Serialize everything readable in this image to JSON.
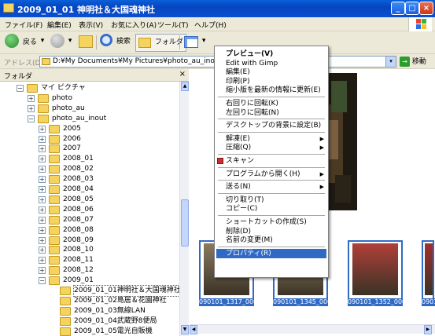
{
  "window": {
    "title": "2009_01_01 神明社＆大国魂神社",
    "min_glyph": "_",
    "max_glyph": "□",
    "close_glyph": "×"
  },
  "menubar": {
    "items": [
      "ファイル(F)",
      "編集(E)",
      "表示(V)",
      "お気に入り(A)",
      "ツール(T)",
      "ヘルプ(H)"
    ]
  },
  "toolbar": {
    "back_label": "戻る",
    "search_label": "検索",
    "folders_label": "フォルダ",
    "dropdown_glyph": "▾"
  },
  "address": {
    "label": "アドレス(D)",
    "value": "D:¥My Documents¥My Pictures¥photo_au_inout¥2009_0",
    "dropdown_glyph": "▾",
    "go_label": "移動",
    "go_glyph": "→"
  },
  "folder_pane": {
    "title": "フォルダ",
    "close_glyph": "×",
    "expand_glyph": "+",
    "collapse_glyph": "−",
    "tree": [
      {
        "label": "マイ ピクチャ",
        "depth": 0,
        "expander": "minus"
      },
      {
        "label": "photo",
        "depth": 1,
        "expander": "plus"
      },
      {
        "label": "photo_au",
        "depth": 1,
        "expander": "plus"
      },
      {
        "label": "photo_au_inout",
        "depth": 1,
        "expander": "minus"
      },
      {
        "label": "2005",
        "depth": 2,
        "expander": "plus"
      },
      {
        "label": "2006",
        "depth": 2,
        "expander": "plus"
      },
      {
        "label": "2007",
        "depth": 2,
        "expander": "plus"
      },
      {
        "label": "2008_01",
        "depth": 2,
        "expander": "plus"
      },
      {
        "label": "2008_02",
        "depth": 2,
        "expander": "plus"
      },
      {
        "label": "2008_03",
        "depth": 2,
        "expander": "plus"
      },
      {
        "label": "2008_04",
        "depth": 2,
        "expander": "plus"
      },
      {
        "label": "2008_05",
        "depth": 2,
        "expander": "plus"
      },
      {
        "label": "2008_06",
        "depth": 2,
        "expander": "plus"
      },
      {
        "label": "2008_07",
        "depth": 2,
        "expander": "plus"
      },
      {
        "label": "2008_08",
        "depth": 2,
        "expander": "plus"
      },
      {
        "label": "2008_09",
        "depth": 2,
        "expander": "plus"
      },
      {
        "label": "2008_10",
        "depth": 2,
        "expander": "plus"
      },
      {
        "label": "2008_11",
        "depth": 2,
        "expander": "plus"
      },
      {
        "label": "2008_12",
        "depth": 2,
        "expander": "plus"
      },
      {
        "label": "2009_01",
        "depth": 2,
        "expander": "minus"
      },
      {
        "label": "2009_01_01神明社＆大国魂神社",
        "depth": 3,
        "expander": "none",
        "selected": true
      },
      {
        "label": "2009_01_02島居＆花園神社",
        "depth": 3,
        "expander": "none"
      },
      {
        "label": "2009_01_03無線LAN",
        "depth": 3,
        "expander": "none"
      },
      {
        "label": "2009_01_04武蔵野8便局",
        "depth": 3,
        "expander": "none"
      },
      {
        "label": "2009_01_05電光自販機",
        "depth": 3,
        "expander": "none"
      }
    ]
  },
  "thumbnails": [
    {
      "caption": "090101_1317_0001"
    },
    {
      "caption": "090101_1345_0001"
    },
    {
      "caption": "090101_1352_0001"
    },
    {
      "caption": "0901"
    }
  ],
  "context_menu": {
    "submenu_glyph": "▶",
    "items": [
      {
        "label": "プレビュー(V)",
        "bold": true
      },
      {
        "label": "Edit with Gimp"
      },
      {
        "label": "編集(E)"
      },
      {
        "label": "印刷(P)"
      },
      {
        "label": "縮小版を最新の情報に更新(E)"
      },
      {
        "sep": true
      },
      {
        "label": "右回りに回転(K)"
      },
      {
        "label": "左回りに回転(N)"
      },
      {
        "sep": true
      },
      {
        "label": "デスクトップの背景に設定(B)"
      },
      {
        "sep": true
      },
      {
        "label": "解凍(E)",
        "submenu": true
      },
      {
        "label": "圧縮(Q)",
        "submenu": true
      },
      {
        "sep": true
      },
      {
        "label": "スキャン",
        "icon": true
      },
      {
        "sep": true
      },
      {
        "label": "プログラムから開く(H)",
        "submenu": true
      },
      {
        "sep": true
      },
      {
        "label": "送る(N)",
        "submenu": true
      },
      {
        "sep": true
      },
      {
        "label": "切り取り(T)"
      },
      {
        "label": "コピー(C)"
      },
      {
        "sep": true
      },
      {
        "label": "ショートカットの作成(S)"
      },
      {
        "label": "削除(D)"
      },
      {
        "label": "名前の変更(M)"
      },
      {
        "sep": true
      },
      {
        "label": "プロパティ(R)",
        "highlighted": true
      }
    ]
  },
  "colors": {
    "titlebar": "#0545c0",
    "chrome": "#ece9d8",
    "selection": "#316ac5",
    "folder": "#f4d35e"
  }
}
